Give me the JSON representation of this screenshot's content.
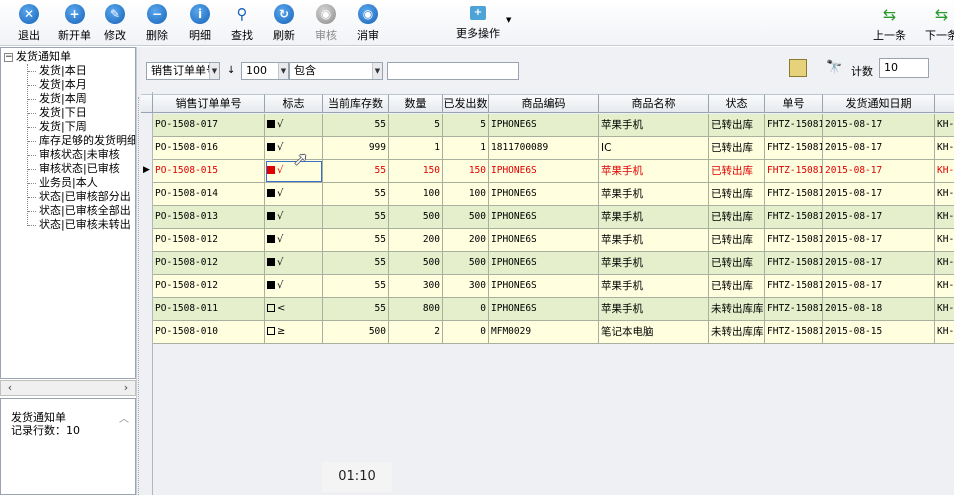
{
  "toolbar": {
    "exit": "退出",
    "new": "新开单",
    "edit": "修改",
    "delete": "删除",
    "detail": "明细",
    "find": "查找",
    "refresh": "刷新",
    "audit": "审核",
    "unaudit": "消审",
    "more": "更多操作",
    "prev": "上一条",
    "next": "下一条"
  },
  "tree": {
    "root": "发货通知单",
    "items": [
      "发货|本日",
      "发货|本月",
      "发货|本周",
      "发货|下日",
      "发货|下周",
      "库存足够的发货明细",
      "审核状态|未审核",
      "审核状态|已审核",
      "业务员|本人",
      "状态|已审核部分出",
      "状态|已审核全部出",
      "状态|已审核未转出"
    ]
  },
  "summary": {
    "title": "发货通知单",
    "records": "记录行数：10"
  },
  "filter": {
    "field": "销售订单单号",
    "sort": "↓",
    "limit": "100",
    "op": "包含",
    "value": "",
    "count_label": "计数",
    "count_value": "10"
  },
  "grid": {
    "columns": [
      "销售订单单号",
      "标志",
      "当前库存数",
      "数量",
      "已发出数",
      "商品编码",
      "商品名称",
      "状态",
      "单号",
      "发货通知日期",
      ""
    ],
    "rows": [
      {
        "order": "PO-1508-017",
        "flag": "solid",
        "flag_glyph": "√",
        "stock": "55",
        "qty": "5",
        "shipped": "5",
        "code": "IPHONE6S",
        "name": "苹果手机",
        "status": "已转出库",
        "no": "FHTZ-15081",
        "date": "2015-08-17",
        "extra": "KH-"
      },
      {
        "order": "PO-1508-016",
        "flag": "solid",
        "flag_glyph": "√",
        "stock": "999",
        "qty": "1",
        "shipped": "1",
        "code": "1811700089",
        "name": "IC",
        "status": "已转出库",
        "no": "FHTZ-15081",
        "date": "2015-08-17",
        "extra": "KH-"
      },
      {
        "order": "PO-1508-015",
        "flag": "red",
        "flag_glyph": "√",
        "stock": "55",
        "qty": "150",
        "shipped": "150",
        "code": "IPHONE6S",
        "name": "苹果手机",
        "status": "已转出库",
        "no": "FHTZ-15081",
        "date": "2015-08-17",
        "extra": "KH-"
      },
      {
        "order": "PO-1508-014",
        "flag": "solid",
        "flag_glyph": "√",
        "stock": "55",
        "qty": "100",
        "shipped": "100",
        "code": "IPHONE6S",
        "name": "苹果手机",
        "status": "已转出库",
        "no": "FHTZ-15081",
        "date": "2015-08-17",
        "extra": "KH-"
      },
      {
        "order": "PO-1508-013",
        "flag": "solid",
        "flag_glyph": "√",
        "stock": "55",
        "qty": "500",
        "shipped": "500",
        "code": "IPHONE6S",
        "name": "苹果手机",
        "status": "已转出库",
        "no": "FHTZ-15081",
        "date": "2015-08-17",
        "extra": "KH-"
      },
      {
        "order": "PO-1508-012",
        "flag": "solid",
        "flag_glyph": "√",
        "stock": "55",
        "qty": "200",
        "shipped": "200",
        "code": "IPHONE6S",
        "name": "苹果手机",
        "status": "已转出库",
        "no": "FHTZ-15081",
        "date": "2015-08-17",
        "extra": "KH-"
      },
      {
        "order": "PO-1508-012",
        "flag": "solid",
        "flag_glyph": "√",
        "stock": "55",
        "qty": "500",
        "shipped": "500",
        "code": "IPHONE6S",
        "name": "苹果手机",
        "status": "已转出库",
        "no": "FHTZ-15081",
        "date": "2015-08-17",
        "extra": "KH-"
      },
      {
        "order": "PO-1508-012",
        "flag": "solid",
        "flag_glyph": "√",
        "stock": "55",
        "qty": "300",
        "shipped": "300",
        "code": "IPHONE6S",
        "name": "苹果手机",
        "status": "已转出库",
        "no": "FHTZ-15081",
        "date": "2015-08-17",
        "extra": "KH-"
      },
      {
        "order": "PO-1508-011",
        "flag": "hollow",
        "flag_glyph": "<",
        "stock": "55",
        "qty": "800",
        "shipped": "0",
        "code": "IPHONE6S",
        "name": "苹果手机",
        "status": "未转出库库存",
        "no": "FHTZ-15081",
        "date": "2015-08-18",
        "extra": "KH-"
      },
      {
        "order": "PO-1508-010",
        "flag": "hollow",
        "flag_glyph": "≥",
        "stock": "500",
        "qty": "2",
        "shipped": "0",
        "code": "MFM0029",
        "name": "笔记本电脑",
        "status": "未转出库库存",
        "no": "FHTZ-15081",
        "date": "2015-08-15",
        "extra": "KH-"
      }
    ],
    "selected_row": 2
  },
  "overlay": {
    "time": "01:10"
  },
  "colors": {
    "row_green": "#e5efcc",
    "row_yellow": "#ffffe0",
    "selected_text": "#e00000",
    "toolbar_icon": "#1763b8"
  }
}
